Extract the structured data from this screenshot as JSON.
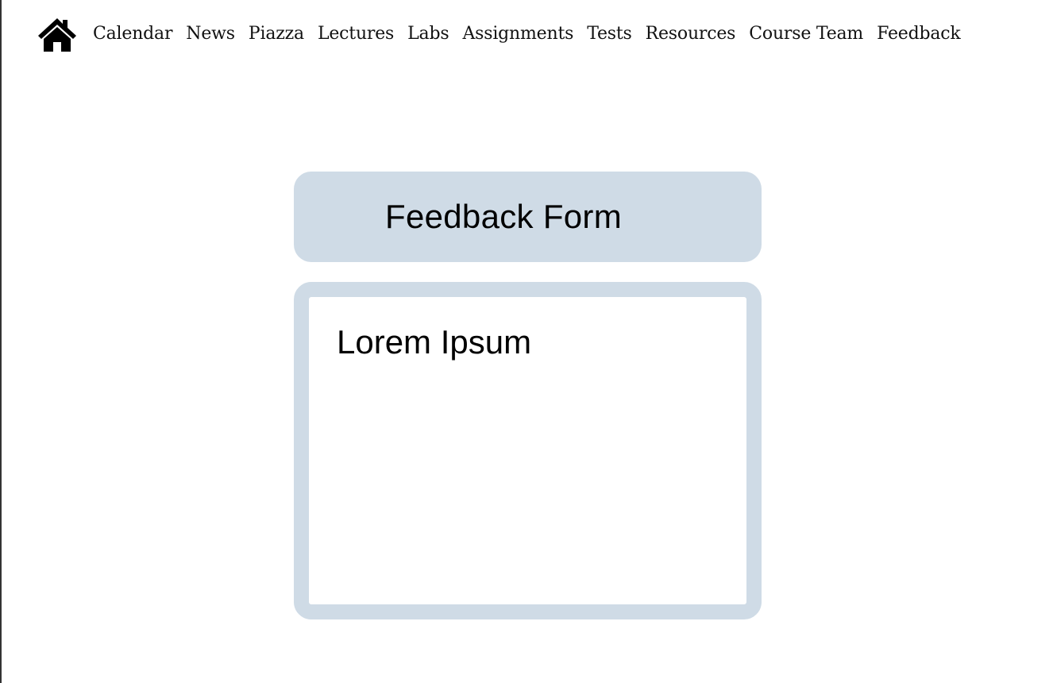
{
  "nav": {
    "home_icon": "home-icon",
    "items": [
      {
        "label": "Calendar"
      },
      {
        "label": "News"
      },
      {
        "label": "Piazza"
      },
      {
        "label": "Lectures"
      },
      {
        "label": "Labs"
      },
      {
        "label": "Assignments"
      },
      {
        "label": "Tests"
      },
      {
        "label": "Resources"
      },
      {
        "label": "Course Team"
      },
      {
        "label": "Feedback"
      }
    ]
  },
  "form": {
    "title": "Feedback Form",
    "body_text": "Lorem Ipsum"
  },
  "colors": {
    "panel": "#cfdbe6",
    "text": "#000000",
    "background": "#ffffff"
  }
}
